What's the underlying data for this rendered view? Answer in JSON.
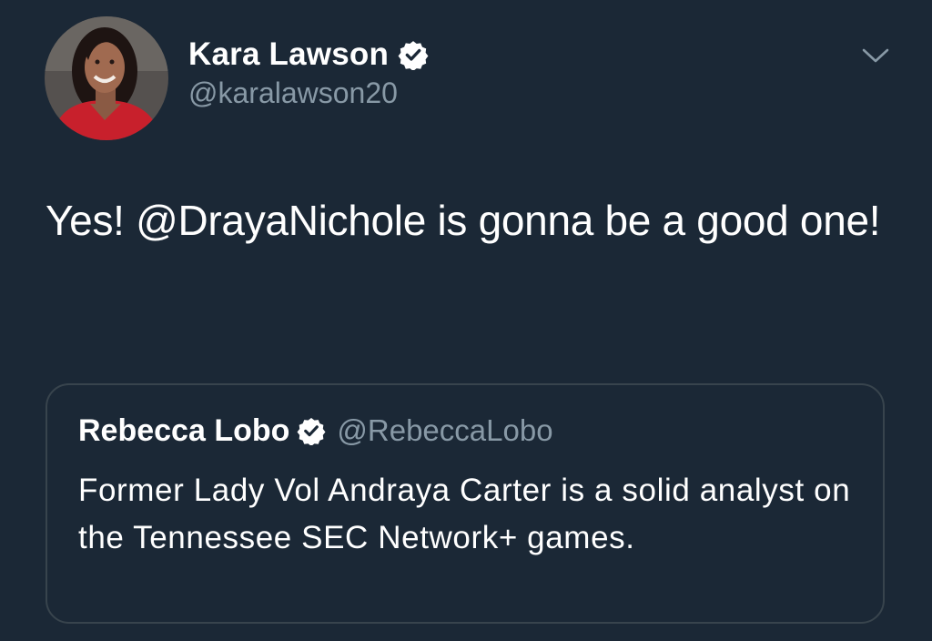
{
  "tweet": {
    "author": {
      "name": "Kara Lawson",
      "handle": "@karalawson20",
      "verified": true,
      "avatar_icon": "profile-photo"
    },
    "text": "Yes! @DrayaNichole is gonna be a good one!",
    "menu_icon": "chevron-down-icon"
  },
  "quoted_tweet": {
    "author": {
      "name": "Rebecca Lobo",
      "handle": "@RebeccaLobo",
      "verified": true
    },
    "text": "Former Lady Vol Andraya Carter is a solid analyst on the Tennessee SEC Network+ games."
  },
  "colors": {
    "background": "#1b2836",
    "text_primary": "#ffffff",
    "text_secondary": "#8899a6",
    "card_border": "#38444d",
    "verified_badge": "#ffffff"
  }
}
